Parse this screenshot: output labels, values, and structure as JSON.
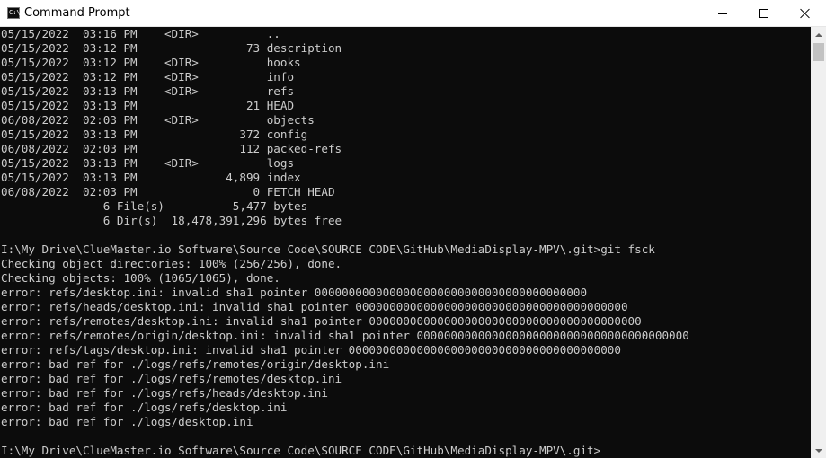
{
  "window": {
    "title": "Command Prompt",
    "icon_label": "C:\\",
    "minimize_label": "",
    "maximize_label": "",
    "close_label": ""
  },
  "colors": {
    "console_bg": "#0c0c0c",
    "console_fg": "#cccccc",
    "titlebar_bg": "#ffffff"
  },
  "console": {
    "lines": [
      "05/15/2022  03:16 PM    <DIR>          ..",
      "05/15/2022  03:12 PM                73 description",
      "05/15/2022  03:12 PM    <DIR>          hooks",
      "05/15/2022  03:12 PM    <DIR>          info",
      "05/15/2022  03:13 PM    <DIR>          refs",
      "05/15/2022  03:13 PM                21 HEAD",
      "06/08/2022  02:03 PM    <DIR>          objects",
      "05/15/2022  03:13 PM               372 config",
      "06/08/2022  02:03 PM               112 packed-refs",
      "05/15/2022  03:13 PM    <DIR>          logs",
      "05/15/2022  03:13 PM             4,899 index",
      "06/08/2022  02:03 PM                 0 FETCH_HEAD",
      "               6 File(s)          5,477 bytes",
      "               6 Dir(s)  18,478,391,296 bytes free",
      "",
      "I:\\My Drive\\ClueMaster.io Software\\Source Code\\SOURCE CODE\\GitHub\\MediaDisplay-MPV\\.git>git fsck",
      "Checking object directories: 100% (256/256), done.",
      "Checking objects: 100% (1065/1065), done.",
      "error: refs/desktop.ini: invalid sha1 pointer 0000000000000000000000000000000000000000",
      "error: refs/heads/desktop.ini: invalid sha1 pointer 0000000000000000000000000000000000000000",
      "error: refs/remotes/desktop.ini: invalid sha1 pointer 0000000000000000000000000000000000000000",
      "error: refs/remotes/origin/desktop.ini: invalid sha1 pointer 0000000000000000000000000000000000000000",
      "error: refs/tags/desktop.ini: invalid sha1 pointer 0000000000000000000000000000000000000000",
      "error: bad ref for ./logs/refs/remotes/origin/desktop.ini",
      "error: bad ref for ./logs/refs/remotes/desktop.ini",
      "error: bad ref for ./logs/refs/heads/desktop.ini",
      "error: bad ref for ./logs/refs/desktop.ini",
      "error: bad ref for ./logs/desktop.ini",
      "",
      "I:\\My Drive\\ClueMaster.io Software\\Source Code\\SOURCE CODE\\GitHub\\MediaDisplay-MPV\\.git>"
    ]
  }
}
